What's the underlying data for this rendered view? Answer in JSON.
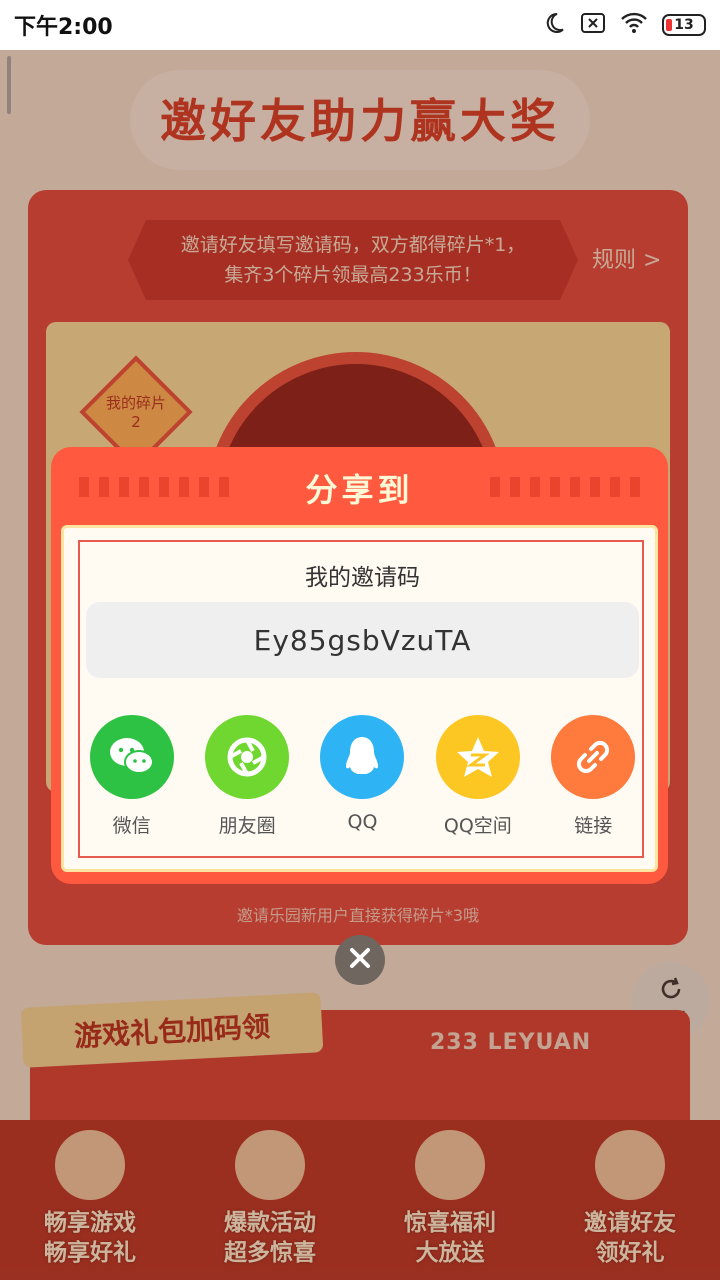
{
  "status_bar": {
    "time": "下午2:00",
    "battery": "13"
  },
  "page": {
    "banner_title": "邀好友助力赢大奖",
    "rules_text_line1": "邀请好友填写邀请码，双方都得碎片*1，",
    "rules_text_line2": "集齐3个碎片领最高233乐币！",
    "rules_link": "规则 >",
    "fragment_label": "我的碎片",
    "fragment_count": "2",
    "panel_footer": "邀请乐园新用户直接获得碎片*3哦",
    "gift_section_title": "游戏礼包加码领",
    "leyuan_text": "233 LEYUAN",
    "refresh_label": "刷新",
    "bottom_nav": [
      {
        "line1": "畅享游戏",
        "line2": "畅享好礼"
      },
      {
        "line1": "爆款活动",
        "line2": "超多惊喜"
      },
      {
        "line1": "惊喜福利",
        "line2": "大放送"
      },
      {
        "line1": "邀请好友",
        "line2": "领好礼"
      }
    ]
  },
  "dialog": {
    "title": "分享到",
    "code_label": "我的邀请码",
    "invite_code": "Ey85gsbVzuTA",
    "share_options": [
      {
        "label": "微信",
        "color": "#2dc243",
        "icon": "wechat-icon"
      },
      {
        "label": "朋友圈",
        "color": "#6fd72f",
        "icon": "moments-icon"
      },
      {
        "label": "QQ",
        "color": "#2eb4f5",
        "icon": "qq-icon"
      },
      {
        "label": "QQ空间",
        "color": "#fcc722",
        "icon": "qzone-icon"
      },
      {
        "label": "链接",
        "color": "#ff7a3d",
        "icon": "link-icon"
      }
    ]
  }
}
